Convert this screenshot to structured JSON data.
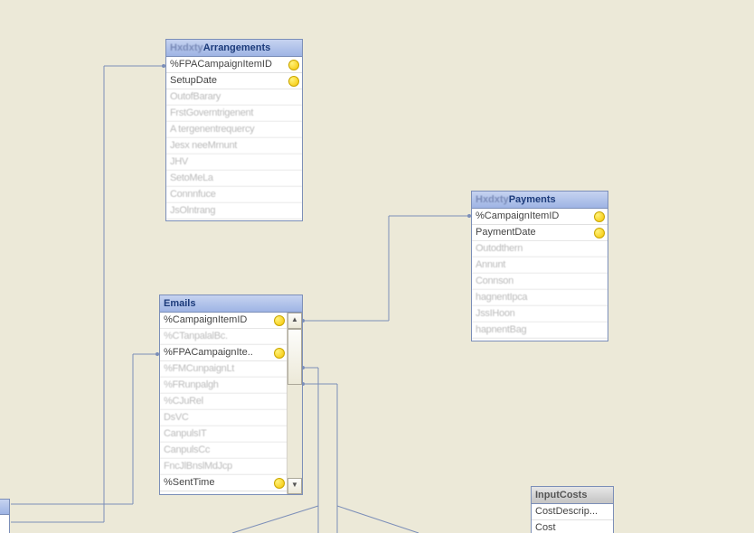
{
  "tables": {
    "arrangements": {
      "title_illegible_prefix": "Hxdxty",
      "title_suffix": "Arrangements",
      "rows": [
        {
          "label": "%FPACampaignItemID",
          "dot": true,
          "blurred": false
        },
        {
          "label": "SetupDate",
          "dot": true,
          "blurred": false
        },
        {
          "label": "OutofBarary",
          "dot": false,
          "blurred": true
        },
        {
          "label": "FrstGoverntrigenent",
          "dot": false,
          "blurred": true
        },
        {
          "label": "A tergenentrequercy",
          "dot": false,
          "blurred": true
        },
        {
          "label": "Jesx neeMrnunt",
          "dot": false,
          "blurred": true
        },
        {
          "label": "JHV",
          "dot": false,
          "blurred": true
        },
        {
          "label": "SetoMeLa",
          "dot": false,
          "blurred": true
        },
        {
          "label": "Connnfuce",
          "dot": false,
          "blurred": true
        },
        {
          "label": "JsOlntrang",
          "dot": false,
          "blurred": true
        }
      ]
    },
    "payments": {
      "title_illegible_prefix": "Hxdxty",
      "title_suffix": "Payments",
      "rows": [
        {
          "label": "%CampaignItemID",
          "dot": true,
          "blurred": false
        },
        {
          "label": "PaymentDate",
          "dot": true,
          "blurred": false
        },
        {
          "label": "Outodthern",
          "dot": false,
          "blurred": true
        },
        {
          "label": "Annunt",
          "dot": false,
          "blurred": true
        },
        {
          "label": "Connson",
          "dot": false,
          "blurred": true
        },
        {
          "label": "hagnentIpca",
          "dot": false,
          "blurred": true
        },
        {
          "label": "JssIHoon",
          "dot": false,
          "blurred": true
        },
        {
          "label": "hapnentBag",
          "dot": false,
          "blurred": true
        }
      ]
    },
    "emails": {
      "title": "Emails",
      "rows": [
        {
          "label": "%CampaignItemID",
          "dot": true,
          "blurred": false
        },
        {
          "label": "%CTanpalalBc.",
          "dot": false,
          "blurred": true
        },
        {
          "label": "%FPACampaignIte..",
          "dot": true,
          "blurred": false
        },
        {
          "label": "%FMCunpaignLt",
          "dot": false,
          "blurred": true
        },
        {
          "label": "%FRunpalgh",
          "dot": false,
          "blurred": true
        },
        {
          "label": "%CJuRel",
          "dot": false,
          "blurred": true
        },
        {
          "label": "DsVC",
          "dot": false,
          "blurred": true
        },
        {
          "label": "CanpulsIT",
          "dot": false,
          "blurred": true
        },
        {
          "label": "CanpulsCc",
          "dot": false,
          "blurred": true
        },
        {
          "label": "FncJlBnslMdJcp",
          "dot": false,
          "blurred": true
        },
        {
          "label": "%SentTime",
          "dot": true,
          "blurred": false
        }
      ]
    },
    "inputcosts": {
      "title": "InputCosts",
      "rows": [
        {
          "label": "CostDescrip...",
          "dot": false,
          "blurred": false
        },
        {
          "label": "Cost",
          "dot": false,
          "blurred": false
        }
      ]
    }
  },
  "colors": {
    "canvas": "#ECE9D8",
    "border": "#7B8EB8",
    "header_start": "#C6D3F0",
    "header_end": "#9EB4E4",
    "dot": "#F6C500"
  }
}
